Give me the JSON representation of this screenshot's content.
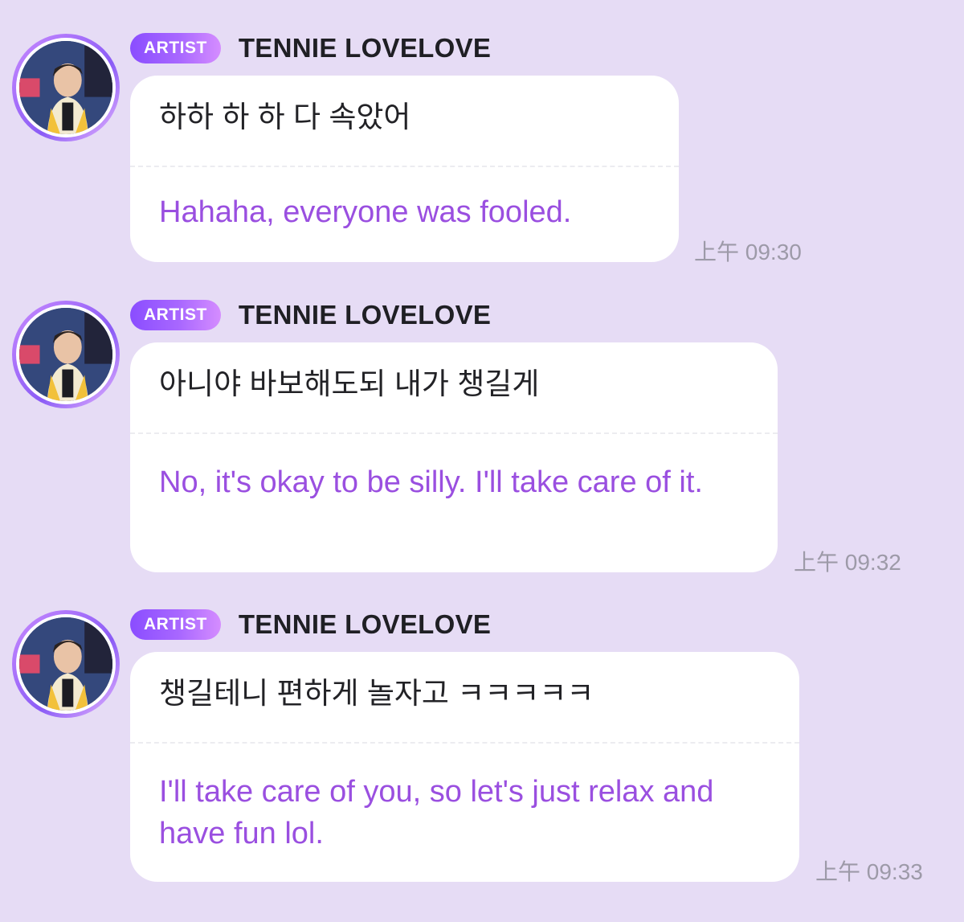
{
  "messages": [
    {
      "badge": "ARTIST",
      "sender": "TENNIE LOVELOVE",
      "korean": "하하 하 하 다 속았어",
      "english": "Hahaha, everyone was fooled.",
      "time": "上午 09:30"
    },
    {
      "badge": "ARTIST",
      "sender": "TENNIE LOVELOVE",
      "korean": "아니야 바보해도되 내가 챙길게",
      "english": "No, it's okay to be silly. I'll take care of it.",
      "time": "上午 09:32"
    },
    {
      "badge": "ARTIST",
      "sender": "TENNIE LOVELOVE",
      "korean": "챙길테니 편하게 놀자고 ㅋㅋㅋㅋㅋ",
      "english": "I'll take care of you, so let's just relax and have fun lol.",
      "time": "上午 09:33"
    }
  ],
  "colors": {
    "background": "#e6dcf5",
    "bubble": "#ffffff",
    "translation_text": "#9a4fe0",
    "badge_start": "#8a4dff",
    "badge_end": "#d58dff",
    "timestamp": "#9d9aa8"
  }
}
